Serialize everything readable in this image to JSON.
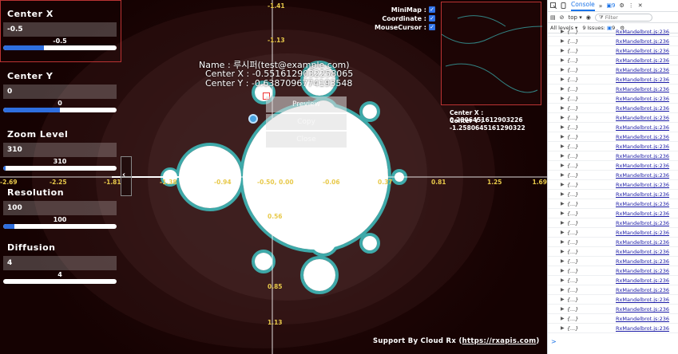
{
  "panels": [
    {
      "title": "Center X",
      "value": "-0.5",
      "slider_label": "-0.5",
      "fill": 0.36
    },
    {
      "title": "Center Y",
      "value": "0",
      "slider_label": "0",
      "fill": 0.5
    },
    {
      "title": "Zoom Level",
      "value": "310",
      "slider_label": "310",
      "fill": 0.02
    },
    {
      "title": "Resolution",
      "value": "100",
      "slider_label": "100",
      "fill": 0.1
    },
    {
      "title": "Diffusion",
      "value": "4",
      "slider_label": "4",
      "fill": 0.0
    }
  ],
  "toggles": [
    {
      "label": "MiniMap :",
      "checked": true
    },
    {
      "label": "Coordinate :",
      "checked": true
    },
    {
      "label": "MouseCursor :",
      "checked": true
    }
  ],
  "info": {
    "name_line": "Name : 루시퍼(test@example.com)",
    "center_x_line": "Center X : -0.5516129032258065",
    "center_y_line": "Center Y : -0.6387096774193548"
  },
  "minimap": {
    "center_x_line": "Center X : 0.2806451612903226",
    "center_y_line": "Center Y : -1.2580645161290322"
  },
  "context_menu": {
    "preview": "Preview",
    "copy": "Copy",
    "close": "Close"
  },
  "axis": {
    "x_labels": [
      "-2.69",
      "-2.25",
      "-1.81",
      "-1.38",
      "-0.94",
      "-0.50, 0.00",
      "-0.06",
      "0.37",
      "0.81",
      "1.25",
      "1.69"
    ],
    "y_labels": [
      "-1.41",
      "-1.13",
      "0.56",
      "0.85",
      "1.13"
    ]
  },
  "support": {
    "text": "Support By Cloud Rx (",
    "link": "https://rxapis.com",
    "end": ")"
  },
  "devtools": {
    "tab_console": "Console",
    "more_tabs": "»",
    "issues_badge": "9",
    "context": "top",
    "filter_placeholder": "Filter",
    "levels": "All levels",
    "issues_text": "9 Issues:",
    "issues_count": "9",
    "log_object": "{...}",
    "log_source": "RxMandelbrot.js:236",
    "log_count": 32,
    "prompt": ">"
  },
  "colors": {
    "accent": "#2f6fdf",
    "axis_label": "#e8c94a",
    "minimap_border": "#b33333",
    "set_body": "#ffffff",
    "edge_glow": "#3fd8d8"
  }
}
